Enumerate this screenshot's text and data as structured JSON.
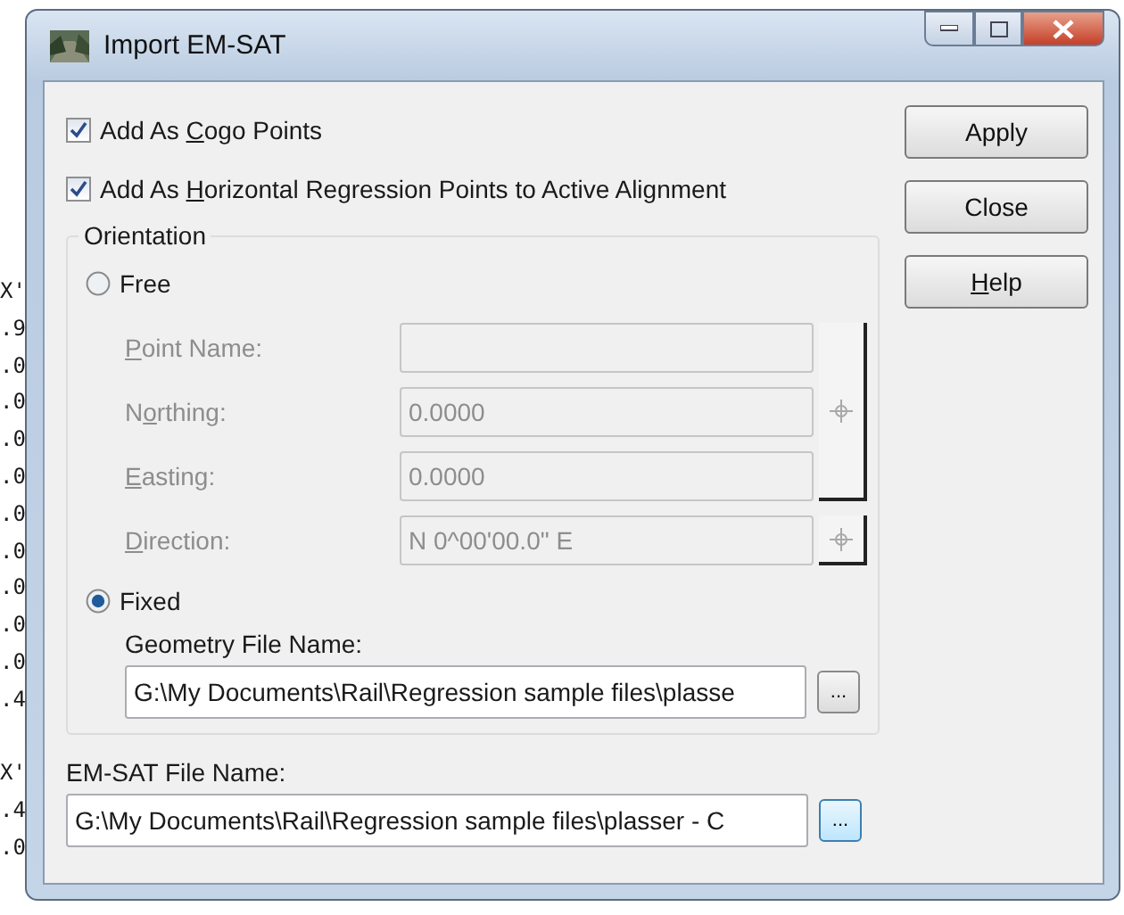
{
  "background_text": {
    "lines": [
      "X'",
      ".9",
      ".0",
      ".0",
      ".0",
      ".0",
      ".0",
      ".0",
      ".0",
      ".0",
      ".0",
      ".4"
    ],
    "lines_lower": [
      "X'",
      ".4",
      ".0"
    ]
  },
  "window": {
    "title": "Import EM-SAT"
  },
  "checkboxes": [
    {
      "label": {
        "before": "Add As ",
        "access_key": "C",
        "after": "ogo Points"
      },
      "checked": true
    },
    {
      "label": {
        "before": "Add As ",
        "access_key": "H",
        "after": "orizontal Regression Points to Active Alignment"
      },
      "checked": true
    }
  ],
  "buttons": [
    {
      "label": "Apply"
    },
    {
      "label": "Close"
    },
    {
      "label": {
        "access_key": "H",
        "after": "elp"
      }
    }
  ],
  "orientation": {
    "title": "Orientation",
    "free": {
      "label": "Free",
      "selected": false
    },
    "fields": [
      {
        "label": {
          "access_key": "P",
          "after": "oint Name:"
        },
        "disabled": true,
        "kind": "grouped"
      },
      {
        "label": {
          "before": "N",
          "access_key": "o",
          "after": "rthing:"
        },
        "value": "0.0000",
        "disabled": true,
        "kind": "grouped"
      },
      {
        "label": {
          "access_key": "E",
          "after": "asting:"
        },
        "value": "0.0000",
        "disabled": true,
        "kind": "grouped"
      },
      {
        "label": {
          "access_key": "D",
          "after": "irection:"
        },
        "value": "N  0^00'00.0\" E",
        "disabled": true,
        "kind": "single"
      }
    ],
    "fixed": {
      "label": "Fixed",
      "selected": true
    },
    "geometry_file": {
      "label": "Geometry File Name:",
      "value": "G:\\My Documents\\Rail\\Regression sample files\\plasse",
      "browse": "..."
    }
  },
  "emsat_file": {
    "label": "EM-SAT File Name:",
    "value": "G:\\My Documents\\Rail\\Regression sample files\\plasser - C",
    "browse": "...",
    "focused": true
  }
}
